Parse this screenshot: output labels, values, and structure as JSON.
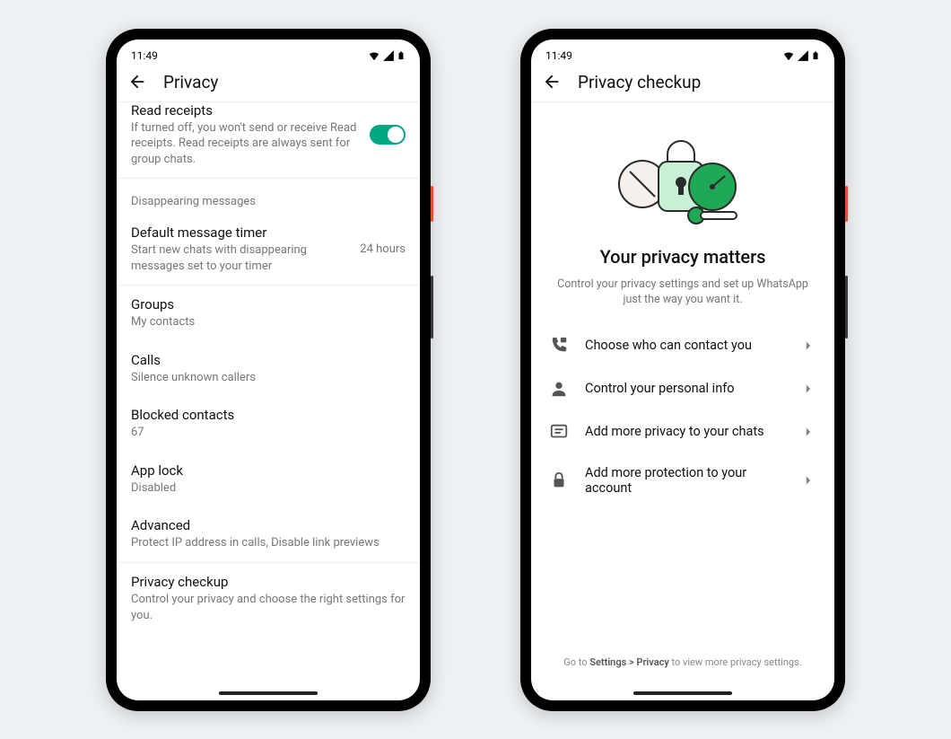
{
  "status": {
    "time": "11:49"
  },
  "left": {
    "title": "Privacy",
    "readReceipts": {
      "title": "Read receipts",
      "sub": "If turned off, you won't send or receive Read receipts. Read receipts are always sent for group chats.",
      "enabled": true
    },
    "disappearingHeader": "Disappearing messages",
    "defaultTimer": {
      "title": "Default message timer",
      "sub": "Start new chats with disappearing messages set to your timer",
      "value": "24 hours"
    },
    "groups": {
      "title": "Groups",
      "sub": "My contacts"
    },
    "calls": {
      "title": "Calls",
      "sub": "Silence unknown callers"
    },
    "blocked": {
      "title": "Blocked contacts",
      "sub": "67"
    },
    "appLock": {
      "title": "App lock",
      "sub": "Disabled"
    },
    "advanced": {
      "title": "Advanced",
      "sub": "Protect IP address in calls, Disable link previews"
    },
    "privacyCheckup": {
      "title": "Privacy checkup",
      "sub": "Control your privacy and choose the right settings for you."
    }
  },
  "right": {
    "title": "Privacy checkup",
    "heroTitle": "Your privacy matters",
    "heroSub": "Control your privacy settings and set up WhatsApp just the way you want it.",
    "items": [
      {
        "label": "Choose who can contact you"
      },
      {
        "label": "Control your personal info"
      },
      {
        "label": "Add more privacy to your chats"
      },
      {
        "label": "Add more protection to your account"
      }
    ],
    "footerPre": "Go to ",
    "footerPath": "Settings > Privacy",
    "footerPost": " to view more privacy settings."
  }
}
